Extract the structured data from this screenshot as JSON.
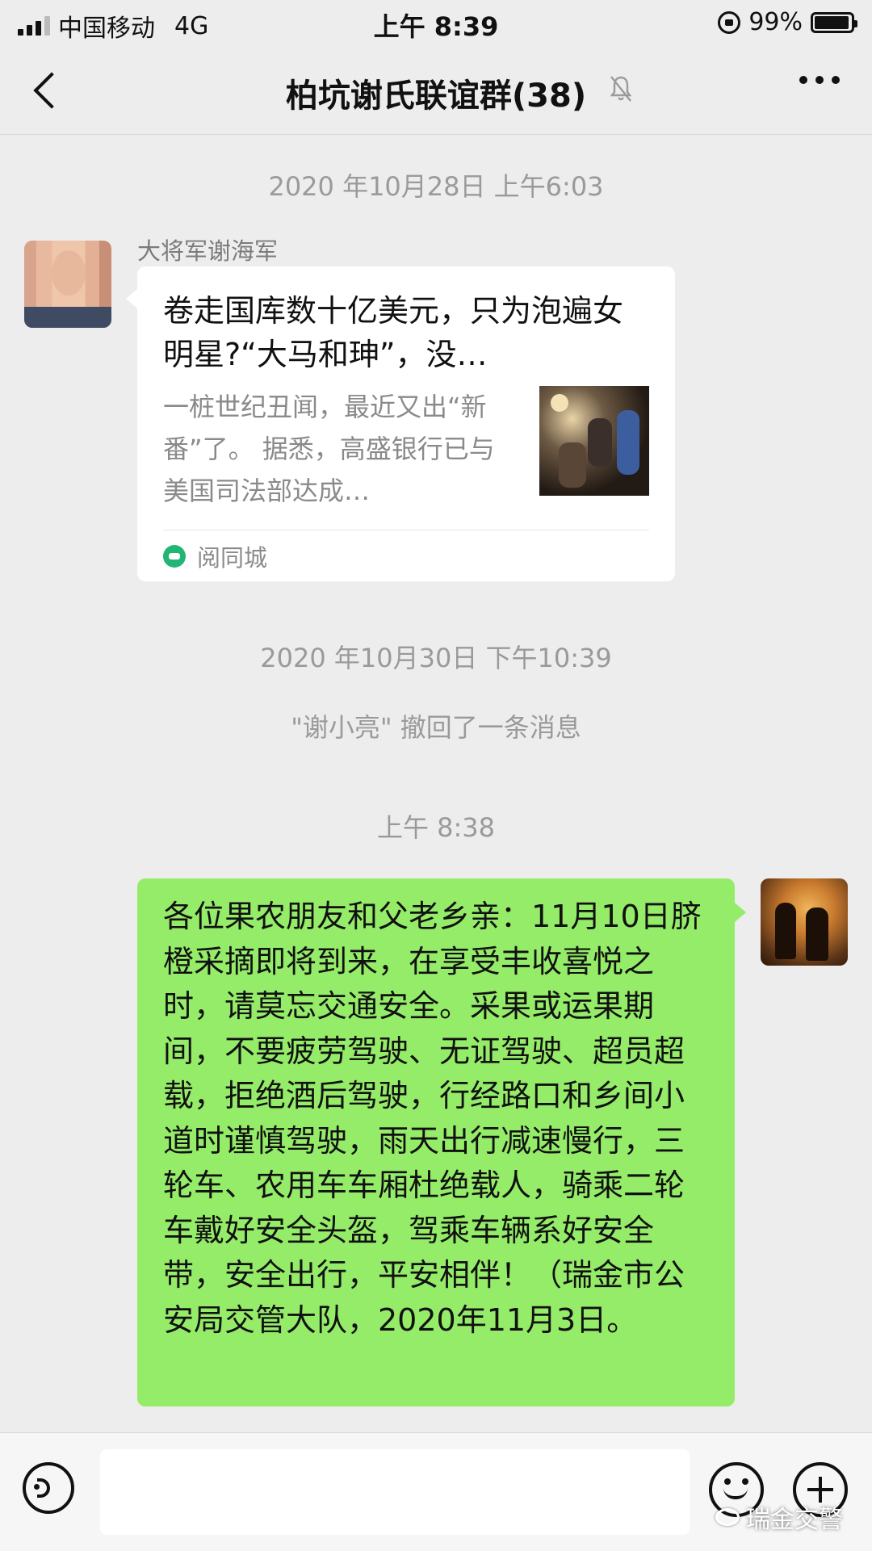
{
  "status_bar": {
    "carrier": "中国移动",
    "network": "4G",
    "time": "上午 8:39",
    "battery": "99%"
  },
  "header": {
    "title": "柏坑谢氏联谊群(38)"
  },
  "messages": {
    "timestamp1": "2020 年10月28日 上午6:03",
    "shared_article": {
      "sender": "大将军谢海军",
      "title": "卷走国库数十亿美元，只为泡遍女明星?“大马和珅”，没…",
      "description": "一桩世纪丑闻，最近又出“新番”了。 据悉，高盛银行已与美国司法部达成…",
      "source": "阅同城"
    },
    "timestamp2": "2020 年10月30日 下午10:39",
    "recall_notice": "\"谢小亮\" 撤回了一条消息",
    "timestamp3": "上午 8:38",
    "self_message": "各位果农朋友和父老乡亲：11月10日脐橙采摘即将到来，在享受丰收喜悦之时，请莫忘交通安全。采果或运果期间，不要疲劳驾驶、无证驾驶、超员超载，拒绝酒后驾驶，行经路口和乡间小道时谨慎驾驶，雨天出行减速慢行，三轮车、农用车车厢杜绝载人，骑乘二轮车戴好安全头盔，驾乘车辆系好安全带，安全出行，平安相伴！（瑞金市公安局交管大队，2020年11月3日。"
  },
  "watermark": "瑞金交警",
  "colors": {
    "background": "#ededed",
    "self_bubble": "#95ec69",
    "card": "#ffffff",
    "source_icon": "#23b573"
  },
  "icons": [
    "signal-icon",
    "lock-rotation-icon",
    "battery-icon",
    "back-icon",
    "mute-bell-icon",
    "more-icon",
    "voice-icon",
    "emoji-icon",
    "plus-icon"
  ]
}
